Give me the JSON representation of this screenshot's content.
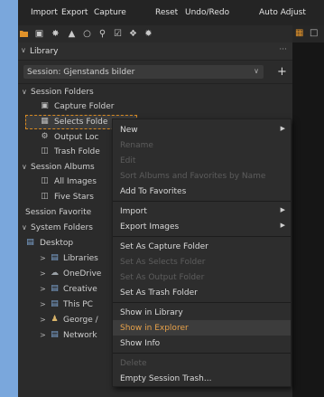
{
  "menubar": {
    "import": "Import",
    "export": "Export",
    "capture": "Capture",
    "reset": "Reset",
    "undo_redo": "Undo/Redo",
    "auto_adjust": "Auto Adjust"
  },
  "library": {
    "title": "Library",
    "more": "···"
  },
  "session": {
    "label": "Session: Gjenstands bilder",
    "add": "+"
  },
  "tree": {
    "session_folders": "Session Folders",
    "capture_folder": "Capture Folder",
    "selects_folder": "Selects Folde",
    "output_location": "Output Loc",
    "trash_folder": "Trash Folde",
    "session_albums": "Session Albums",
    "all_images": "All Images",
    "five_stars": "Five Stars",
    "session_favorites": "Session Favorite",
    "system_folders": "System Folders",
    "desktop": "Desktop",
    "libraries": "Libraries",
    "onedrive": "OneDrive",
    "creative": "Creative",
    "this_pc": "This PC",
    "george": "George /",
    "network": "Network"
  },
  "context_menu": {
    "new": "New",
    "rename": "Rename",
    "edit": "Edit",
    "sort_albums": "Sort Albums and Favorites by Name",
    "add_to_favorites": "Add To Favorites",
    "import": "Import",
    "export_images": "Export Images",
    "set_capture": "Set As Capture Folder",
    "set_selects": "Set As Selects Folder",
    "set_output": "Set As Output Folder",
    "set_trash": "Set As Trash Folder",
    "show_in_library": "Show in Library",
    "show_in_explorer": "Show in Explorer",
    "show_info": "Show Info",
    "delete": "Delete",
    "empty_trash": "Empty Session Trash..."
  },
  "colors": {
    "accent": "#e8a24a",
    "selection_border": "#d88a22",
    "folder": "#e0922a",
    "background": "#7aa7dc"
  }
}
